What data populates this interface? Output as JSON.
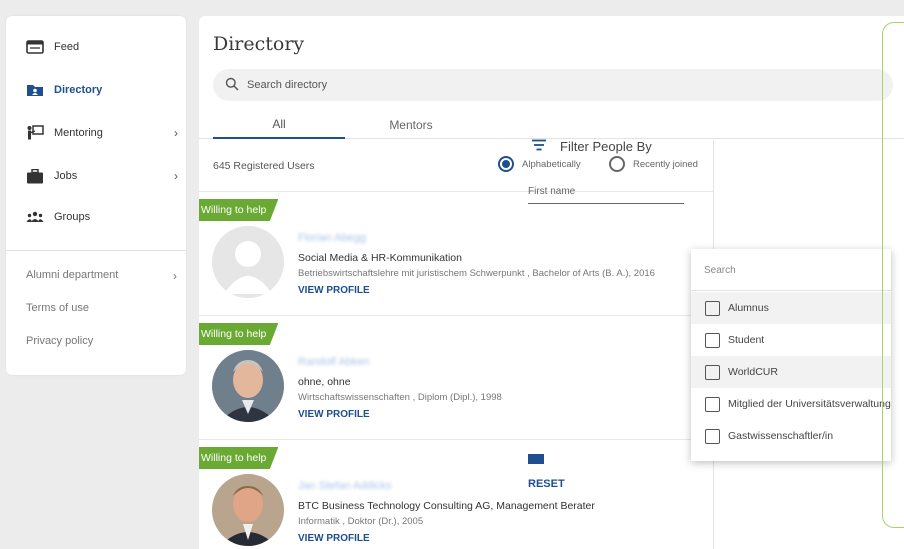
{
  "sidebar": {
    "items": [
      {
        "label": "Feed",
        "icon": "feed-icon"
      },
      {
        "label": "Directory",
        "icon": "directory-icon"
      },
      {
        "label": "Mentoring",
        "icon": "mentoring-icon"
      },
      {
        "label": "Jobs",
        "icon": "briefcase-icon"
      },
      {
        "label": "Groups",
        "icon": "groups-icon"
      }
    ],
    "links": [
      "Alumni department",
      "Terms of use",
      "Privacy policy"
    ]
  },
  "main": {
    "title": "Directory",
    "search_placeholder": "Search directory",
    "tabs": [
      "All",
      "Mentors"
    ],
    "registered": "645 Registered Users",
    "sort": [
      "Alphabetically",
      "Recently joined"
    ]
  },
  "cards": [
    {
      "ribbon": "Willing to help",
      "name": "Florian Abegg",
      "line1": "Social Media & HR-Kommunikation",
      "line2": "Betriebswirtschaftslehre mit juristischem Schwerpunkt , Bachelor of Arts (B. A.), 2016",
      "link": "VIEW PROFILE"
    },
    {
      "ribbon": "Willing to help",
      "name": "Randolf Abken",
      "line1": "ohne, ohne",
      "line2": "Wirtschaftswissenschaften , Diplom (Dipl.), 1998",
      "link": "VIEW PROFILE"
    },
    {
      "ribbon": "Willing to help",
      "name": "Jan Stefan Addicks",
      "line1": "BTC Business Technology Consulting AG, Management Berater",
      "line2": "Informatik , Doktor (Dr.), 2005",
      "link": "VIEW PROFILE"
    }
  ],
  "filter": {
    "title": "Filter People By",
    "first_name": "First name",
    "reset": "RESET"
  },
  "dropdown": {
    "search": "Search",
    "options": [
      "Alumnus",
      "Student",
      "WorldCUR",
      "Mitglied der Universitätsverwaltung",
      "Gastwissenschaftler/in"
    ]
  },
  "colors": {
    "accent": "#1f4f8f",
    "ribbon": "#6aaa34",
    "highlight": "#a6d46b"
  }
}
